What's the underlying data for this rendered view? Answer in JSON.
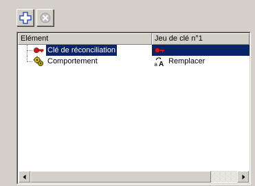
{
  "toolbar": {
    "add_button": {
      "icon": "plus-icon",
      "enabled": true
    },
    "delete_button": {
      "icon": "delete-x-icon",
      "enabled": false
    }
  },
  "grid": {
    "columns": [
      {
        "label": "Elément"
      },
      {
        "label": "Jeu de clé n°1"
      }
    ],
    "rows": [
      {
        "element": "Clé de réconciliation",
        "element_icon": "key-icon",
        "value": "",
        "value_icon": "key-icon",
        "selected": true
      },
      {
        "element": "Comportement",
        "element_icon": "gears-icon",
        "value": "Remplacer",
        "value_icon": "replace-icon",
        "selected": false
      }
    ]
  },
  "colors": {
    "selection": "#0a246a",
    "window": "#d4d0c8",
    "add_icon": "#3050d0",
    "key": "#d01818"
  }
}
